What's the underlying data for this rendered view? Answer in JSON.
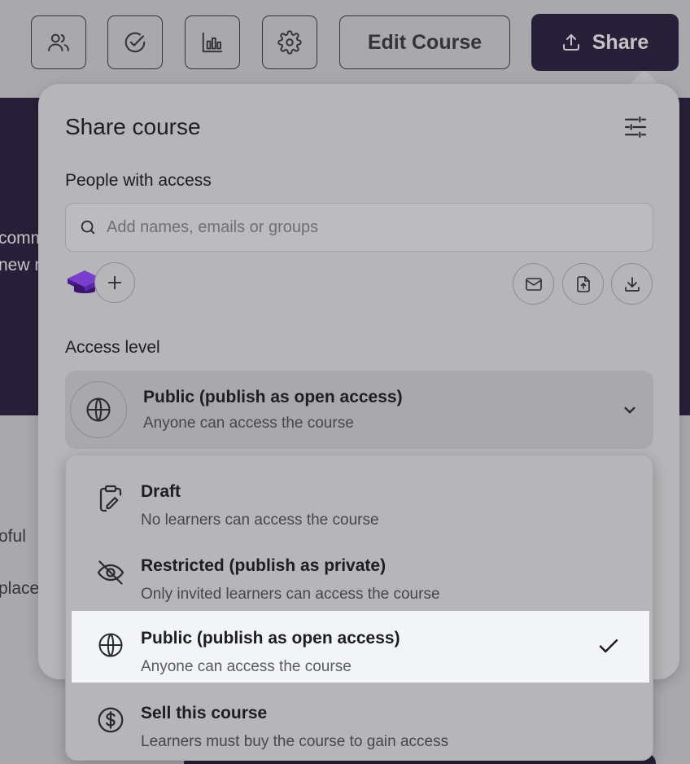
{
  "toolbar": {
    "buttons": [
      {
        "icon": "users-icon"
      },
      {
        "icon": "check-circle-icon"
      },
      {
        "icon": "bar-chart-icon"
      },
      {
        "icon": "gear-icon"
      }
    ],
    "edit_label": "Edit Course",
    "share_label": "Share"
  },
  "background": {
    "hero_line_1": "comm",
    "hero_line_2": "new r",
    "body_line_1": "oful",
    "body_line_2": "place"
  },
  "panel": {
    "title": "Share course",
    "people_label": "People with access",
    "search_placeholder": "Add names, emails or groups",
    "search_value": "",
    "access_label": "Access level",
    "current_access": {
      "title": "Public (publish as open access)",
      "subtitle": "Anyone can access the course"
    }
  },
  "dropdown": {
    "options": [
      {
        "icon": "clipboard-pen-icon",
        "title": "Draft",
        "subtitle": "No learners can access the course",
        "selected": false
      },
      {
        "icon": "eye-off-icon",
        "title": "Restricted (publish as private)",
        "subtitle": "Only invited learners can access the course",
        "selected": false
      },
      {
        "icon": "globe-icon",
        "title": "Public (publish as open access)",
        "subtitle": "Anyone can access the course",
        "selected": true
      },
      {
        "icon": "dollar-circle-icon",
        "title": "Sell this course",
        "subtitle": "Learners must buy the course to gain access",
        "selected": false
      }
    ]
  },
  "colors": {
    "brand_dark": "#1a0d2e",
    "selected_bg": "#f3f4f6",
    "avatar_purple": "#6b2fb5"
  }
}
